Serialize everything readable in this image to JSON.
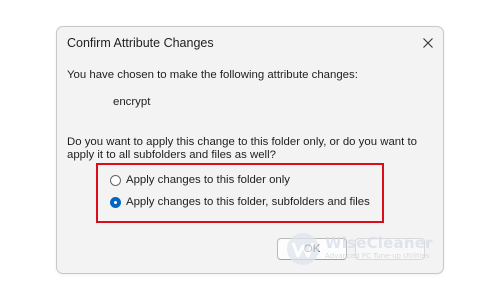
{
  "dialog": {
    "title": "Confirm Attribute Changes",
    "intro": "You have chosen to make the following attribute changes:",
    "attribute_change": "encrypt",
    "question_line1": "Do you want to apply this change to this folder only, or do you want to",
    "question_line2": "apply it to all subfolders and files as well?",
    "options": [
      {
        "label": "Apply changes to this folder only",
        "selected": false
      },
      {
        "label": "Apply changes to this folder, subfolders and files",
        "selected": true
      }
    ],
    "ok_label": "OK"
  },
  "watermark": {
    "name": "WiseCleaner",
    "tagline": "Advanced PC Tune-up Utilities"
  },
  "colors": {
    "accent": "#0067c0",
    "highlight_border": "#e00b1a",
    "dialog_background": "#f3f3f3"
  },
  "icons": {
    "close": "close-icon",
    "watermark_logo": "wisecleaner-logo-icon"
  }
}
